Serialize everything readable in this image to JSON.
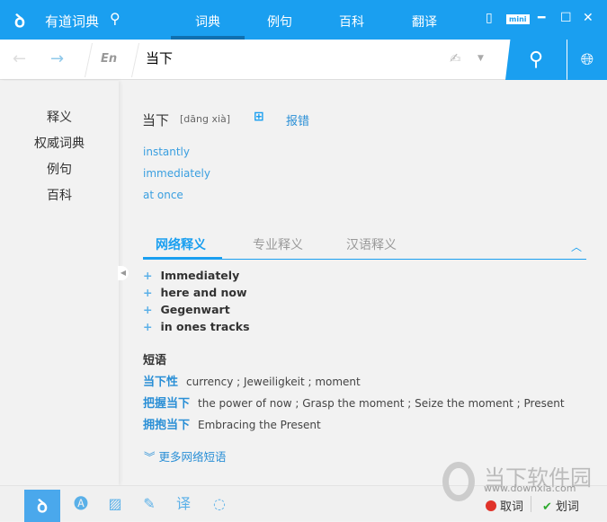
{
  "app": {
    "name": "有道词典",
    "brand_color": "#1a9ff0"
  },
  "nav_tabs": [
    {
      "label": "词典",
      "active": true
    },
    {
      "label": "例句"
    },
    {
      "label": "百科"
    },
    {
      "label": "翻译"
    }
  ],
  "window": {
    "mini_label": "mini"
  },
  "search": {
    "lang": "En",
    "query": "当下"
  },
  "sidebar": {
    "items": [
      {
        "label": "释义"
      },
      {
        "label": "权威词典"
      },
      {
        "label": "例句"
      },
      {
        "label": "百科"
      }
    ]
  },
  "entry": {
    "word": "当下",
    "phonetic": "[dāng xià]",
    "report_label": "报错",
    "translations": [
      "instantly",
      "immediately",
      "at once"
    ]
  },
  "def_tabs": [
    {
      "label": "网络释义",
      "active": true
    },
    {
      "label": "专业释义"
    },
    {
      "label": "汉语释义"
    }
  ],
  "web_defs": [
    "Immediately",
    "here and now",
    "Gegenwart",
    "in ones tracks"
  ],
  "phrases": {
    "heading": "短语",
    "items": [
      {
        "term": "当下性",
        "meaning": "currency ; Jeweiligkeit ; moment"
      },
      {
        "term": "把握当下",
        "meaning": "the power of now ; Grasp the moment ; Seize the moment ; Present"
      },
      {
        "term": "拥抱当下",
        "meaning": "Embracing the Present"
      }
    ],
    "more_label": "更多网络短语"
  },
  "bottom": {
    "cancel_label": "取词",
    "huaci_label": "划词"
  },
  "watermark": {
    "text": "当下软件园",
    "url": "www.downxia.com"
  }
}
